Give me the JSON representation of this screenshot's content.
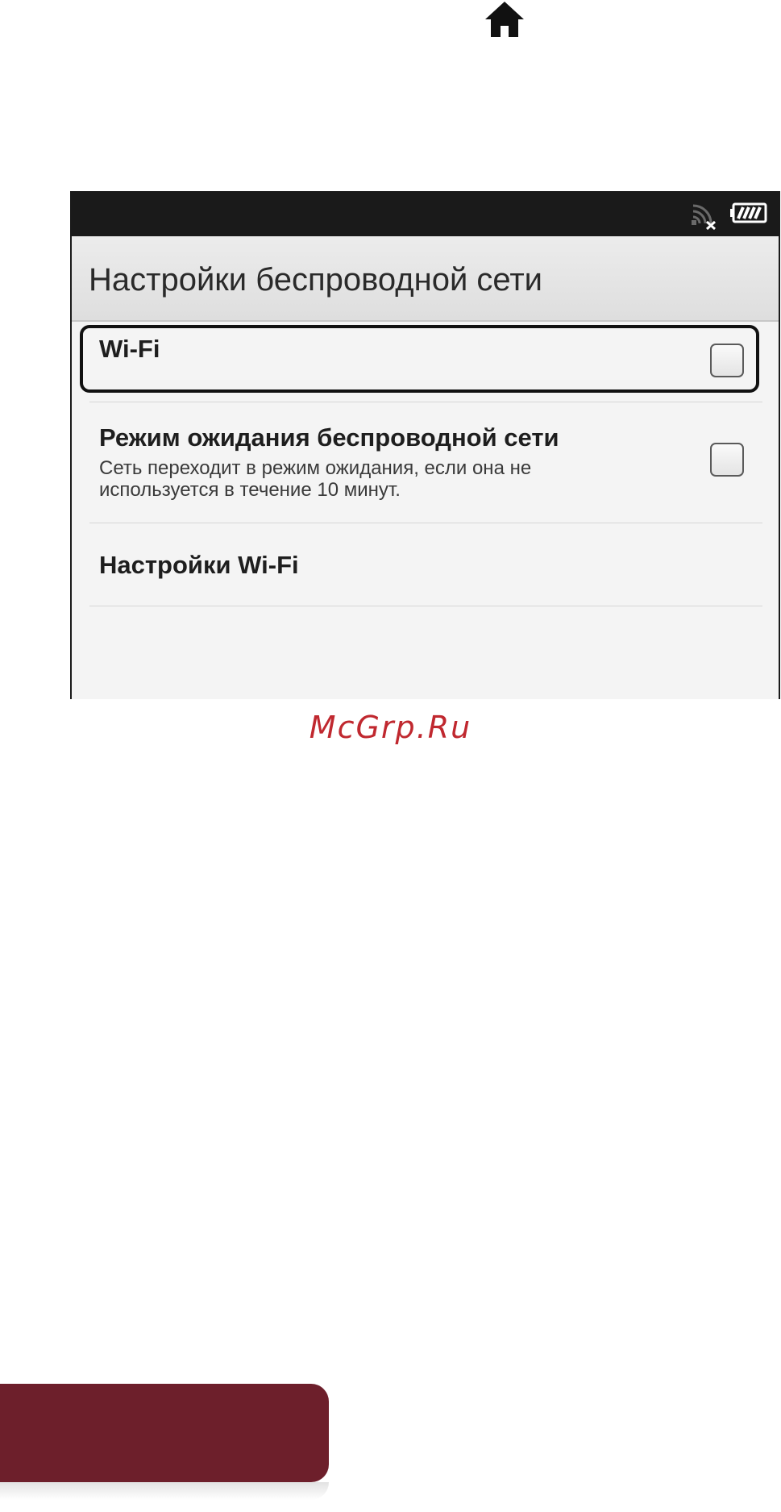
{
  "header": {
    "home_icon": "home-icon"
  },
  "status_bar": {
    "icons": [
      "wifi-off-icon",
      "battery-icon"
    ]
  },
  "screen": {
    "title": "Настройки беспроводной сети",
    "items": [
      {
        "label": "Wi-Fi",
        "checked": false,
        "highlighted": true
      },
      {
        "label": "Режим ожидания беспроводной сети",
        "description": "Сеть переходит в режим ожидания, если она не используется в течение 10 минут.",
        "checked": false
      },
      {
        "label": "Настройки Wi-Fi"
      }
    ]
  },
  "watermark": "McGrp.Ru",
  "colors": {
    "watermark": "#c0282f",
    "bottom_tab": "#6d1f2b",
    "status_bar": "#1a1a1a"
  }
}
